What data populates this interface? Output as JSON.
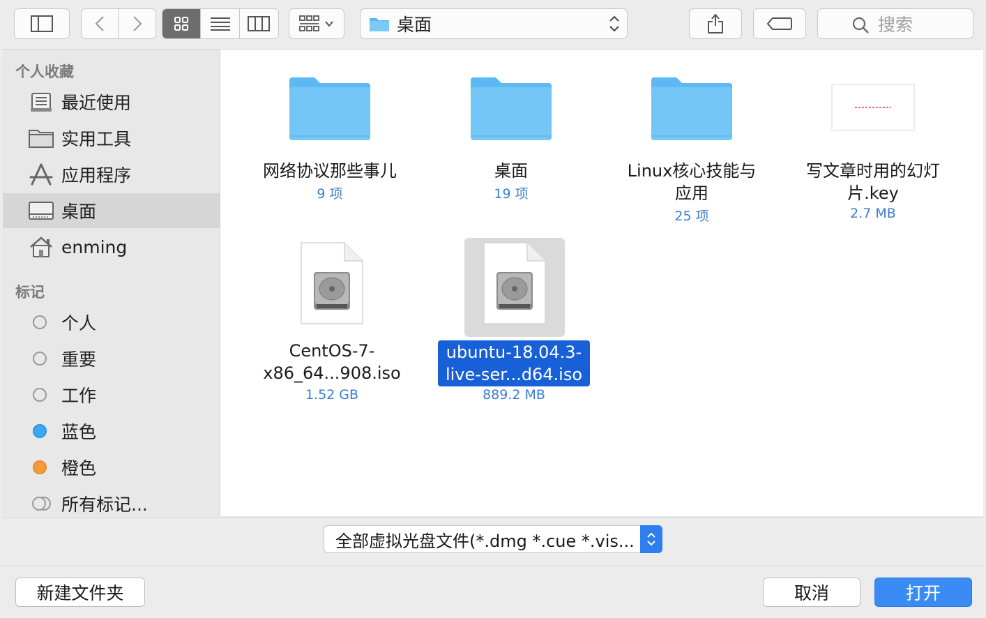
{
  "toolbar": {
    "path_label": "桌面",
    "search_placeholder": "搜索"
  },
  "sidebar": {
    "favorites_title": "个人收藏",
    "favorites": [
      {
        "label": "最近使用",
        "icon": "recents-icon"
      },
      {
        "label": "实用工具",
        "icon": "folder-icon"
      },
      {
        "label": "应用程序",
        "icon": "applications-icon"
      },
      {
        "label": "桌面",
        "icon": "desktop-icon",
        "selected": true
      },
      {
        "label": "enming",
        "icon": "home-icon"
      }
    ],
    "tags_title": "标记",
    "tags": [
      {
        "label": "个人",
        "color": "#e8e8e8"
      },
      {
        "label": "重要",
        "color": "#e8e8e8"
      },
      {
        "label": "工作",
        "color": "#e8e8e8"
      },
      {
        "label": "蓝色",
        "color": "#3ba8f5"
      },
      {
        "label": "橙色",
        "color": "#f79a3a"
      },
      {
        "label": "所有标记...",
        "color": "multi"
      }
    ]
  },
  "files": [
    {
      "name_line1": "网络协议那些事儿",
      "name_line2": "",
      "meta": "9 项",
      "type": "folder"
    },
    {
      "name_line1": "桌面",
      "name_line2": "",
      "meta": "19 项",
      "type": "folder"
    },
    {
      "name_line1": "Linux核心技能与",
      "name_line2": "应用",
      "meta": "25 项",
      "type": "folder"
    },
    {
      "name_line1": "写文章时用的幻灯",
      "name_line2": "片.key",
      "meta": "2.7 MB",
      "type": "keynote"
    },
    {
      "name_line1": "CentOS-7-",
      "name_line2": "x86_64...908.iso",
      "meta": "1.52 GB",
      "type": "disk-image"
    },
    {
      "name_line1": "ubuntu-18.04.3-",
      "name_line2": "live-ser...d64.iso",
      "meta": "889.2 MB",
      "type": "disk-image",
      "selected": true
    }
  ],
  "filter": {
    "label": "全部虚拟光盘文件(*.dmg *.cue *.vis..."
  },
  "buttons": {
    "new_folder": "新建文件夹",
    "cancel": "取消",
    "open": "打开"
  },
  "colors": {
    "accent": "#1860d8",
    "folder": "#6cc4f5",
    "meta_text": "#3a7dd4"
  }
}
